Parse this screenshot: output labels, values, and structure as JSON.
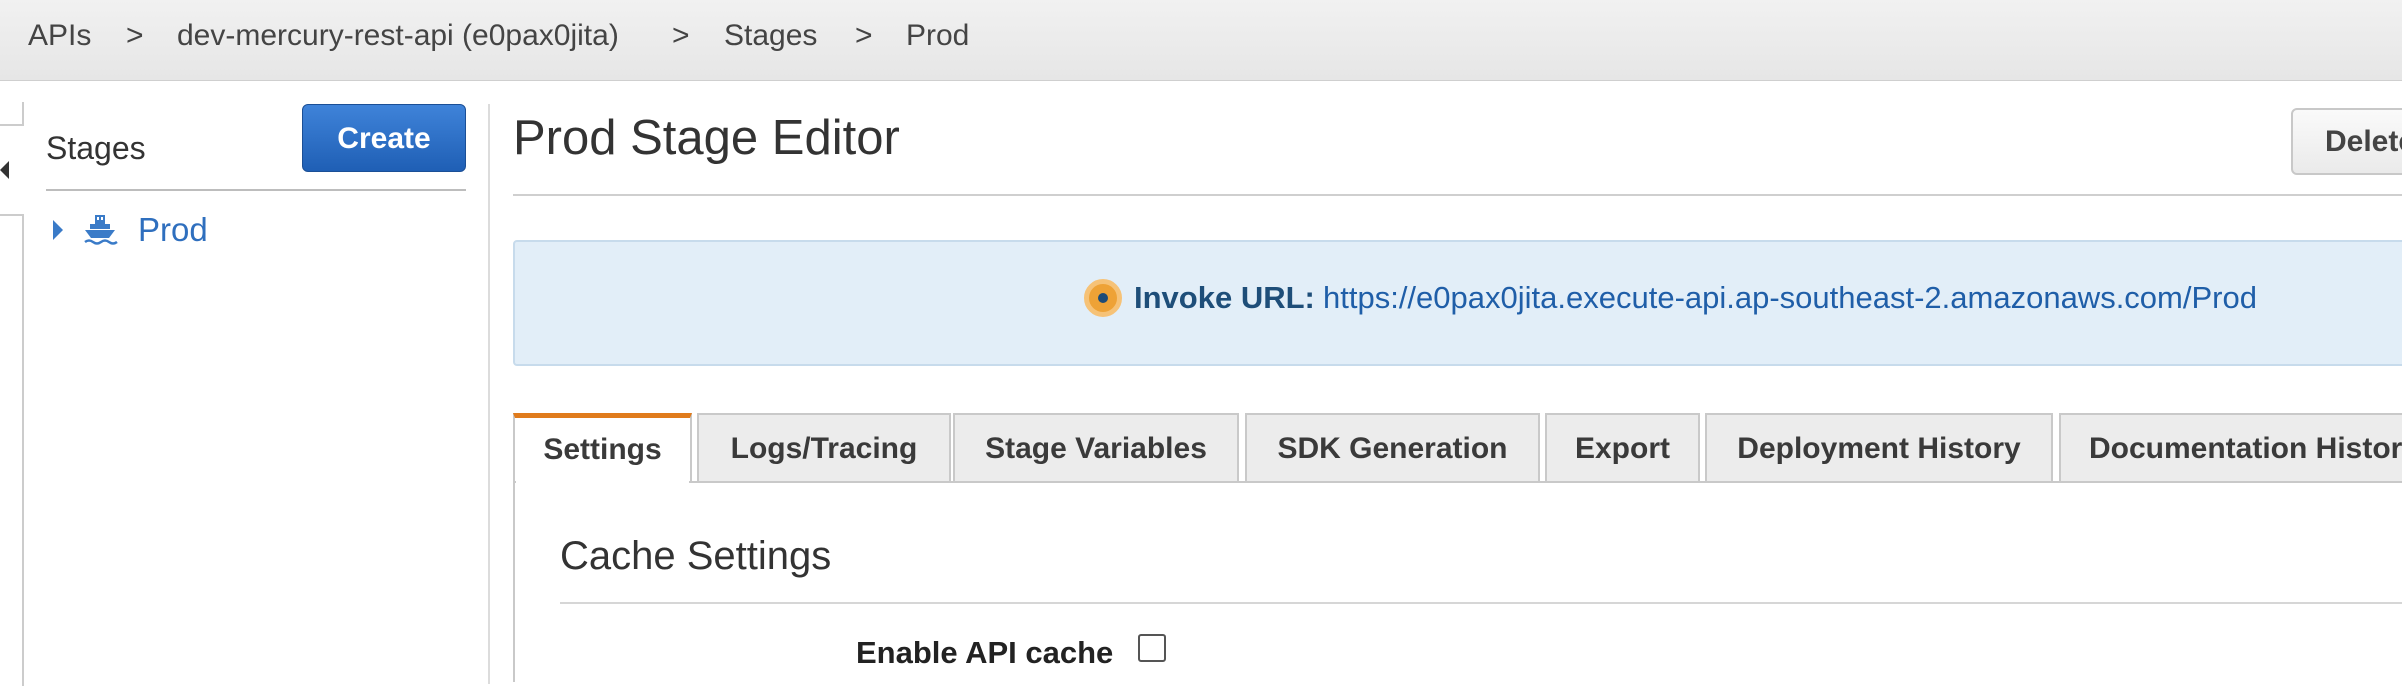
{
  "breadcrumb": {
    "items": [
      "APIs",
      "dev-mercury-rest-api (e0pax0jita)",
      "Stages",
      "Prod"
    ],
    "separator": ">"
  },
  "sidebar": {
    "title": "Stages",
    "create_label": "Create",
    "stages": [
      {
        "label": "Prod",
        "icon": "ship-icon",
        "expanded": false
      }
    ]
  },
  "editor": {
    "title": "Prod Stage Editor",
    "delete_label": "Delete",
    "invoke": {
      "label": "Invoke URL:",
      "url": "https://e0pax0jita.execute-api.ap-southeast-2.amazonaws.com/Prod"
    },
    "tabs": [
      {
        "label": "Settings",
        "active": true
      },
      {
        "label": "Logs/Tracing",
        "active": false
      },
      {
        "label": "Stage Variables",
        "active": false
      },
      {
        "label": "SDK Generation",
        "active": false
      },
      {
        "label": "Export",
        "active": false
      },
      {
        "label": "Deployment History",
        "active": false
      },
      {
        "label": "Documentation History",
        "active": false
      }
    ],
    "cache": {
      "title": "Cache Settings",
      "enable_label": "Enable API cache",
      "enabled": false
    }
  },
  "colors": {
    "accent_blue": "#2f6fbe",
    "create_button": "#2b6fc7",
    "active_tab_border": "#e07b1c",
    "invoke_background": "#e2eef8",
    "status_dot": "#eea236"
  }
}
